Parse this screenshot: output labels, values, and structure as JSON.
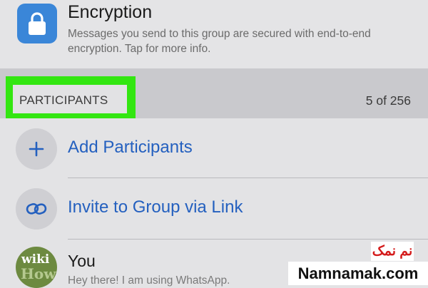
{
  "encryption": {
    "title": "Encryption",
    "description": "Messages you send to this group are secured with end-to-end encryption. Tap for more info.",
    "icon": "lock-icon",
    "icon_bg": "#3a86d8"
  },
  "participants_section": {
    "label": "PARTICIPANTS",
    "count": "5 of 256",
    "highlight_color": "#33e611"
  },
  "actions": [
    {
      "label": "Add Participants",
      "icon": "plus-icon"
    },
    {
      "label": "Invite to Group via Link",
      "icon": "link-icon"
    }
  ],
  "participant": {
    "name": "You",
    "status": "Hey there! I am using WhatsApp.",
    "avatar_line1": "wiki",
    "avatar_line2": "How"
  },
  "watermark": {
    "persian": "نم نمک",
    "site": "Namnamak.com"
  },
  "colors": {
    "link_blue": "#2460bf",
    "section_bg": "#c9c9cd"
  }
}
